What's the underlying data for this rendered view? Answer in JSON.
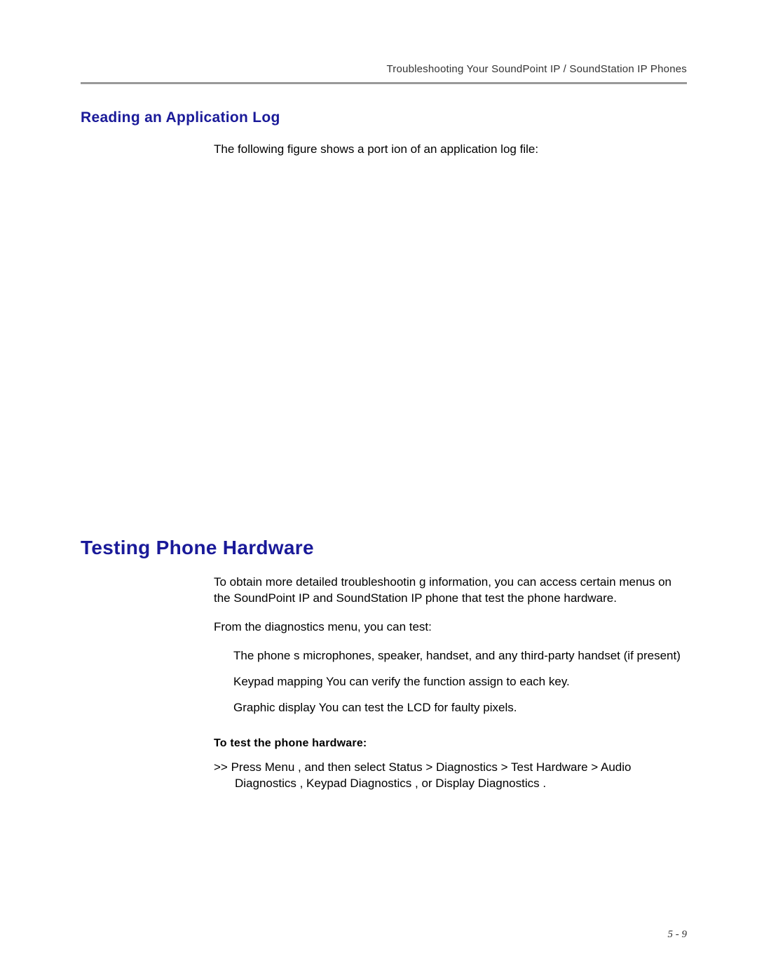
{
  "header": {
    "chapterTitle": "Troubleshooting Your SoundPoint IP / SoundStation IP Phones"
  },
  "section1": {
    "heading": "Reading an Application Log",
    "intro": "The following figure shows a port ion of an application log file:"
  },
  "section2": {
    "heading": "Testing Phone Hardware",
    "para1": "To obtain more detailed troubleshootin g information, you can access certain menus on the SoundPoint IP and SoundStation IP phone that test the phone hardware.",
    "para2": "From the diagnostics menu, you can test:",
    "bullets": [
      "The phone s microphones, speaker, handset, and any third-party handset (if present)",
      "Keypad mapping You can verify the function assign to each key.",
      "Graphic display You can test the LCD for faulty pixels."
    ],
    "subheading": "To test the phone hardware:",
    "step": ">>  Press Menu , and then select Status > Diagnostics  > Test Hardware  > Audio Diagnostics  , Keypad Diagnostics , or Display Diagnostics ."
  },
  "footer": {
    "pageNumber": "5 - 9"
  }
}
